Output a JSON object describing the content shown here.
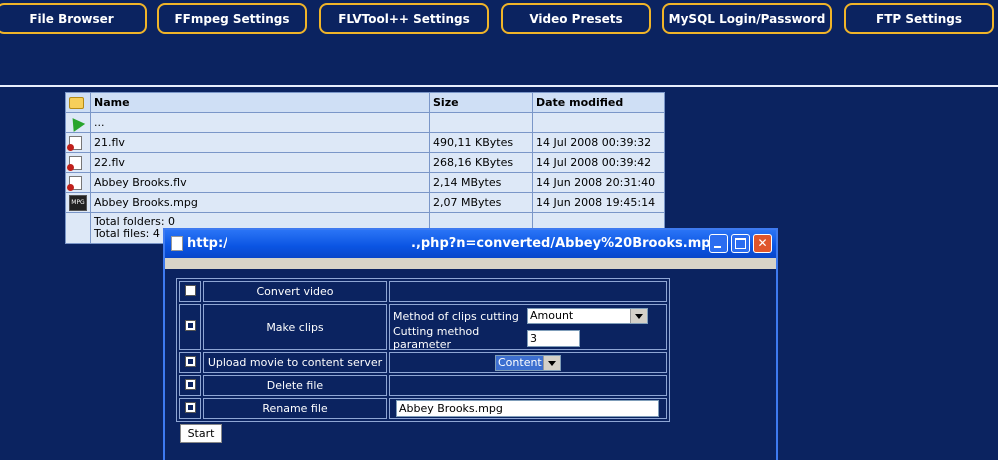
{
  "nav": {
    "file_browser": "File Browser",
    "ffmpeg": "FFmpeg Settings",
    "flvtool": "FLVTool++ Settings",
    "video_presets": "Video Presets",
    "mysql": "MySQL Login/Password",
    "ftp": "FTP Settings"
  },
  "files": {
    "headers": {
      "name": "Name",
      "size": "Size",
      "date": "Date modified"
    },
    "up": "...",
    "rows": [
      {
        "name": "21.flv",
        "size": "490,11 KBytes",
        "date": "14 Jul 2008 00:39:32",
        "icon": "flv-icon"
      },
      {
        "name": "22.flv",
        "size": "268,16 KBytes",
        "date": "14 Jul 2008 00:39:42",
        "icon": "flv-icon"
      },
      {
        "name": "Abbey Brooks.flv",
        "size": "2,14 MBytes",
        "date": "14 Jun 2008 20:31:40",
        "icon": "flv-icon"
      },
      {
        "name": "Abbey Brooks.mpg",
        "size": "2,07 MBytes",
        "date": "14 Jun 2008 19:45:14",
        "icon": "mpg-icon"
      }
    ],
    "total_folders": "Total folders: 0",
    "total_files": "Total files: 4"
  },
  "popup": {
    "title_left": "http:/",
    "title_right": ".,php?n=converted/Abbey%20Brooks.mpg",
    "mpg_badge": "MPG",
    "convert_video": "Convert video",
    "make_clips": "Make clips",
    "method_label": "Method of clips cutting",
    "method_value": "Amount",
    "param_label": "Cutting method parameter",
    "param_value": "3",
    "upload_label": "Upload movie to content server",
    "content_value": "Content",
    "delete_label": "Delete file",
    "rename_label": "Rename file",
    "rename_value": "Abbey Brooks.mpg",
    "start": "Start"
  }
}
